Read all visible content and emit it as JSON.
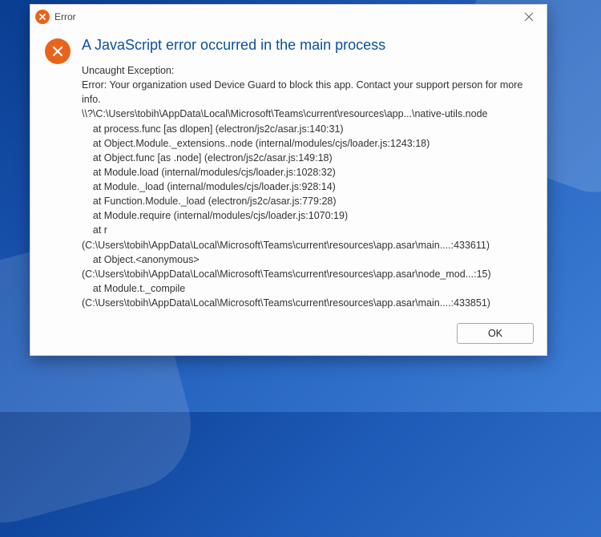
{
  "titlebar": {
    "title": "Error"
  },
  "dialog": {
    "heading": "A JavaScript error occurred in the main process",
    "stack": [
      "Uncaught Exception:",
      "Error: Your organization used Device Guard to block this app. Contact your support person for more info.",
      "\\\\?\\C:\\Users\\tobih\\AppData\\Local\\Microsoft\\Teams\\current\\resources\\app...\\native-utils.node",
      "    at process.func [as dlopen] (electron/js2c/asar.js:140:31)",
      "    at Object.Module._extensions..node (internal/modules/cjs/loader.js:1243:18)",
      "    at Object.func [as .node] (electron/js2c/asar.js:149:18)",
      "    at Module.load (internal/modules/cjs/loader.js:1028:32)",
      "    at Module._load (internal/modules/cjs/loader.js:928:14)",
      "    at Function.Module._load (electron/js2c/asar.js:779:28)",
      "    at Module.require (internal/modules/cjs/loader.js:1070:19)",
      "    at r",
      "(C:\\Users\\tobih\\AppData\\Local\\Microsoft\\Teams\\current\\resources\\app.asar\\main....:433611)",
      "    at Object.<anonymous>",
      "(C:\\Users\\tobih\\AppData\\Local\\Microsoft\\Teams\\current\\resources\\app.asar\\node_mod...:15)",
      "    at Module.t._compile",
      "(C:\\Users\\tobih\\AppData\\Local\\Microsoft\\Teams\\current\\resources\\app.asar\\main....:433851)"
    ],
    "ok_label": "OK"
  },
  "colors": {
    "accent": "#e8641b",
    "heading": "#0b4f9e"
  }
}
